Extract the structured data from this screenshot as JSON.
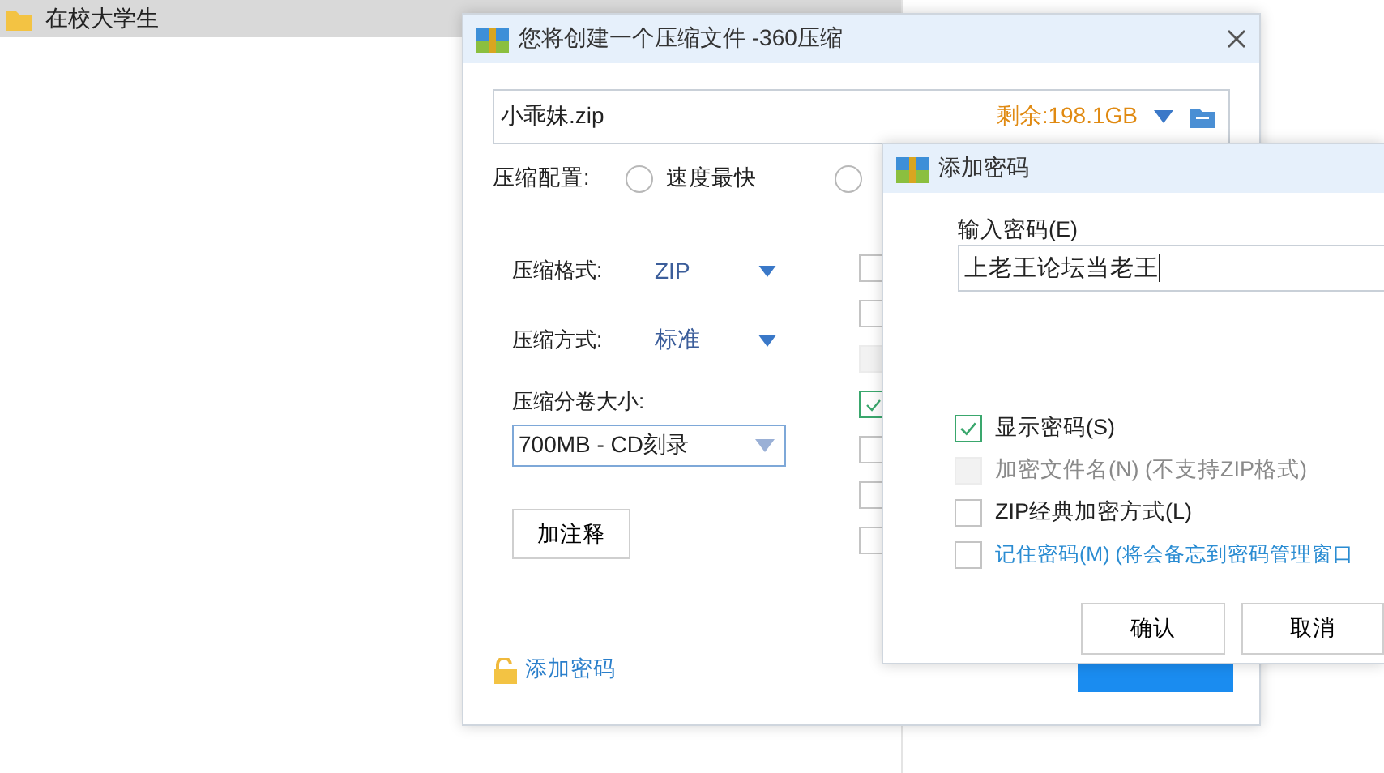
{
  "explorer": {
    "row": {
      "name": "在校大学生",
      "selected": true
    }
  },
  "main_dialog": {
    "title": "您将创建一个压缩文件 -360压缩",
    "filename": "小乖妹.zip",
    "free_space": "剩余:198.1GB",
    "config_label": "压缩配置:",
    "config_radios": [
      {
        "label": "速度最快",
        "selected": false
      },
      {
        "selected": false
      }
    ],
    "format_label": "压缩格式:",
    "format_value": "ZIP",
    "method_label": "压缩方式:",
    "method_value": "标准",
    "split_label": "压缩分卷大小:",
    "split_value": "700MB   - CD刻录",
    "comment_button": "加注释",
    "add_password_link": "添加密码",
    "options": [
      {
        "checked": false,
        "disabled": false
      },
      {
        "checked": false,
        "disabled": false
      },
      {
        "checked": false,
        "disabled": true
      },
      {
        "checked": true,
        "disabled": false
      },
      {
        "checked": false,
        "disabled": false
      },
      {
        "checked": false,
        "disabled": false
      },
      {
        "checked": false,
        "disabled": false
      }
    ]
  },
  "password_dialog": {
    "title": "添加密码",
    "input_label": "输入密码(E)",
    "password": "上老王论坛当老王",
    "options": [
      {
        "label": "显示密码(S)",
        "checked": true,
        "disabled": false,
        "link": false
      },
      {
        "label": "加密文件名(N) (不支持ZIP格式)",
        "checked": false,
        "disabled": true,
        "link": false
      },
      {
        "label": "ZIP经典加密方式(L)",
        "checked": false,
        "disabled": false,
        "link": false
      },
      {
        "label": "记住密码(M) (将会备忘到密码管理窗口",
        "checked": false,
        "disabled": false,
        "link": true
      }
    ],
    "buttons": [
      "确认",
      "取消"
    ]
  }
}
